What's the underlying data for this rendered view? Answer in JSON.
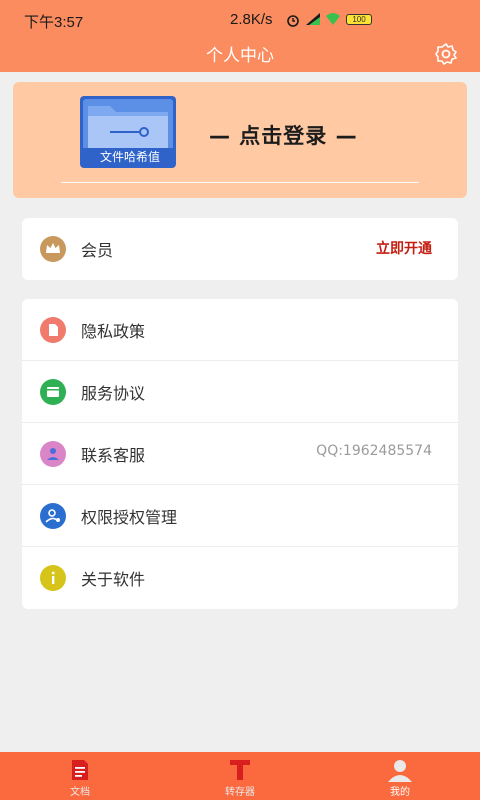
{
  "status": {
    "time": "下午3:57",
    "speed": "2.8K/s",
    "battery": "100"
  },
  "header": {
    "title": "个人中心"
  },
  "login": {
    "logo_text": "文件哈希值",
    "prompt": "— 点击登录 —"
  },
  "vip": {
    "label": "会员",
    "action": "立即开通"
  },
  "menu": [
    {
      "label": "隐私政策",
      "icon": "privacy-icon",
      "color": "#f07a6c"
    },
    {
      "label": "服务协议",
      "icon": "agreement-icon",
      "color": "#2fb055"
    },
    {
      "label": "联系客服",
      "icon": "service-icon",
      "color": "#d985c8",
      "extra": "QQ:1962485574"
    },
    {
      "label": "权限授权管理",
      "icon": "permission-icon",
      "color": "#2a6fd0"
    },
    {
      "label": "关于软件",
      "icon": "info-icon",
      "color": "#d6c41a"
    }
  ],
  "tabs": [
    {
      "label": "文档",
      "icon": "document-icon"
    },
    {
      "label": "转存器",
      "icon": "text-tool-icon"
    },
    {
      "label": "我的",
      "icon": "profile-icon"
    }
  ],
  "colors": {
    "accent": "#fb8c5f",
    "tabbar": "#fb6a3e",
    "login_card": "#fec9a3",
    "vip_action": "#c41e12"
  }
}
